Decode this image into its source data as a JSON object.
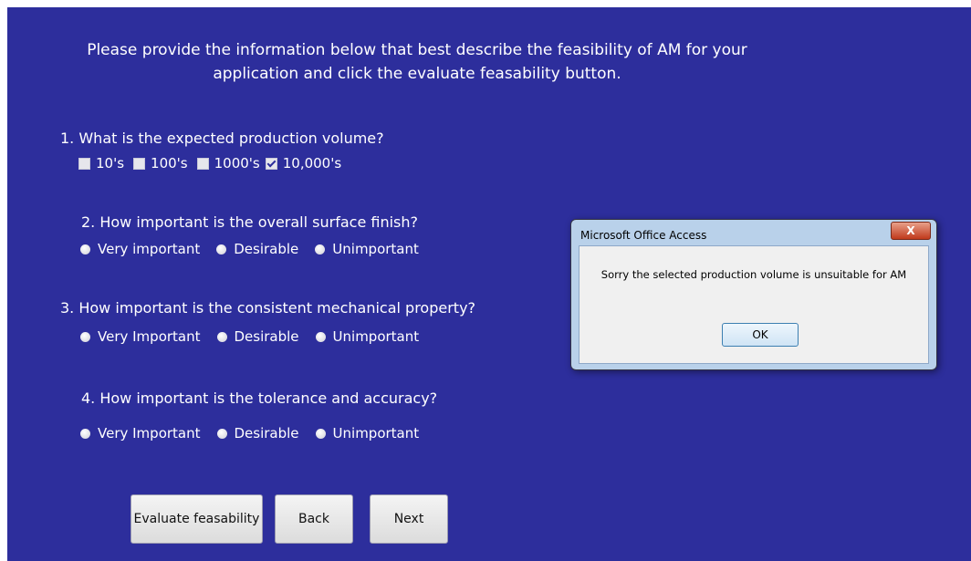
{
  "intro": {
    "line1": "Please provide the information below that best describe the feasibility of AM for your",
    "line2": "application and click the evaluate feasability button."
  },
  "questions": [
    {
      "text": "1. What is the expected production volume?",
      "options": [
        "10's",
        "100's",
        "1000's",
        "10,000's"
      ],
      "selected": "10,000's"
    },
    {
      "text": "2. How important is the overall surface finish?",
      "options": [
        "Very important",
        "Desirable",
        "Unimportant"
      ]
    },
    {
      "text": "3. How important is the consistent mechanical property?",
      "options": [
        "Very Important",
        "Desirable",
        "Unimportant"
      ]
    },
    {
      "text": "4. How important is the tolerance and accuracy?",
      "options": [
        "Very Important",
        "Desirable",
        "Unimportant"
      ]
    }
  ],
  "buttons": {
    "evaluate": "Evaluate feasability",
    "back": "Back",
    "next": "Next"
  },
  "dialog": {
    "title": "Microsoft Office Access",
    "close": "X",
    "message": "Sorry the selected production volume is unsuitable for AM",
    "ok": "OK"
  },
  "colors": {
    "form_bg": "#2d2e9c",
    "dialog_frame": "#b9d1ea"
  }
}
